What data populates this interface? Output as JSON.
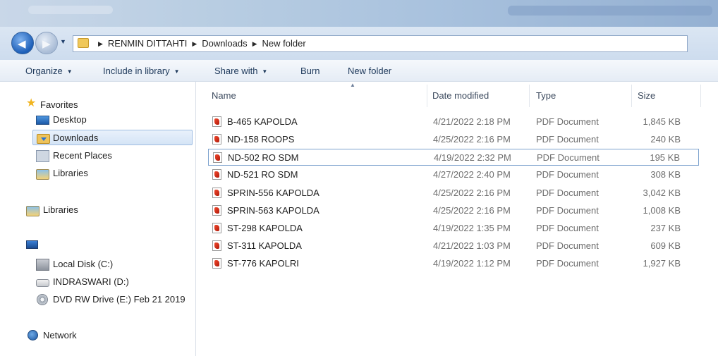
{
  "address": {
    "breadcrumbs": [
      "RENMIN DITTAHTI",
      "Downloads",
      "New folder"
    ]
  },
  "toolbar": {
    "organize": "Organize",
    "include_library": "Include in library",
    "share_with": "Share with",
    "burn": "Burn",
    "new_folder": "New folder"
  },
  "nav": {
    "favorites": "Favorites",
    "desktop": "Desktop",
    "downloads": "Downloads",
    "recent_places": "Recent Places",
    "libraries_fav": "Libraries",
    "libraries": "Libraries",
    "local_disk": "Local Disk (C:)",
    "indraswari": "INDRASWARI  (D:)",
    "dvd": "DVD RW Drive (E:) Feb 21 2019",
    "network": "Network"
  },
  "columns": {
    "name": "Name",
    "date": "Date modified",
    "type": "Type",
    "size": "Size"
  },
  "files": [
    {
      "name": "B-465 KAPOLDA",
      "date": "4/21/2022 2:18 PM",
      "type": "PDF Document",
      "size": "1,845 KB"
    },
    {
      "name": "ND-158 ROOPS",
      "date": "4/25/2022 2:16 PM",
      "type": "PDF Document",
      "size": "240 KB"
    },
    {
      "name": "ND-502 RO SDM",
      "date": "4/19/2022 2:32 PM",
      "type": "PDF Document",
      "size": "195 KB"
    },
    {
      "name": "ND-521 RO SDM",
      "date": "4/27/2022 2:40 PM",
      "type": "PDF Document",
      "size": "308 KB"
    },
    {
      "name": "SPRIN-556 KAPOLDA",
      "date": "4/25/2022 2:16 PM",
      "type": "PDF Document",
      "size": "3,042 KB"
    },
    {
      "name": "SPRIN-563 KAPOLDA",
      "date": "4/25/2022 2:16 PM",
      "type": "PDF Document",
      "size": "1,008 KB"
    },
    {
      "name": "ST-298 KAPOLDA",
      "date": "4/19/2022 1:35 PM",
      "type": "PDF Document",
      "size": "237 KB"
    },
    {
      "name": "ST-311 KAPOLDA",
      "date": "4/21/2022 1:03 PM",
      "type": "PDF Document",
      "size": "609 KB"
    },
    {
      "name": "ST-776 KAPOLRI",
      "date": "4/19/2022 1:12 PM",
      "type": "PDF Document",
      "size": "1,927 KB"
    }
  ]
}
